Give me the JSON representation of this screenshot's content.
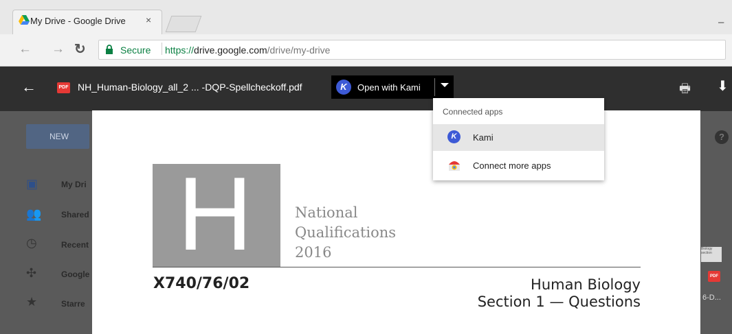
{
  "browser": {
    "tab_title": "My Drive - Google Drive",
    "tab_close": "×",
    "window_minimize": "–",
    "secure_label": "Secure",
    "url_scheme": "https://",
    "url_host": "drive.google.com",
    "url_path": "/drive/my-drive",
    "back_glyph": "←",
    "forward_glyph": "→",
    "reload_glyph": "↻"
  },
  "drive": {
    "new_button": "NEW",
    "sidebar": [
      {
        "label": "My Dri",
        "icon": "my-drive-icon"
      },
      {
        "label": "Shared",
        "icon": "shared-icon"
      },
      {
        "label": "Recent",
        "icon": "recent-icon"
      },
      {
        "label": "Google",
        "icon": "google-photos-icon"
      },
      {
        "label": "Starre",
        "icon": "starred-icon"
      }
    ],
    "right_thumbs": {
      "thumb1": "Biology section",
      "thumb2": "PDF",
      "thumb3": "6-D..."
    }
  },
  "viewer": {
    "back_glyph": "←",
    "pdf_badge": "PDF",
    "file_name": "NH_Human-Biology_all_2 ... -DQP-Spellcheckoff.pdf",
    "open_with_label": "Open with Kami",
    "kami_letter": "K",
    "print_glyph": "🖶",
    "download_glyph": "⬇"
  },
  "menu": {
    "header": "Connected apps",
    "items": [
      {
        "label": "Kami",
        "icon": "kami-icon"
      },
      {
        "label": "Connect more apps",
        "icon": "chrome-web-store-icon"
      }
    ]
  },
  "pdf": {
    "big_letter": "H",
    "nq_line1": "National",
    "nq_line2": "Qualifications",
    "nq_line3": "2016",
    "paper_code": "X740/76/02",
    "subject": "Human Biology",
    "section": "Section 1 — Questions"
  },
  "colors": {
    "accent_blue": "#3d5ad6",
    "secure_green": "#0b8043",
    "pdf_red": "#e53935"
  }
}
